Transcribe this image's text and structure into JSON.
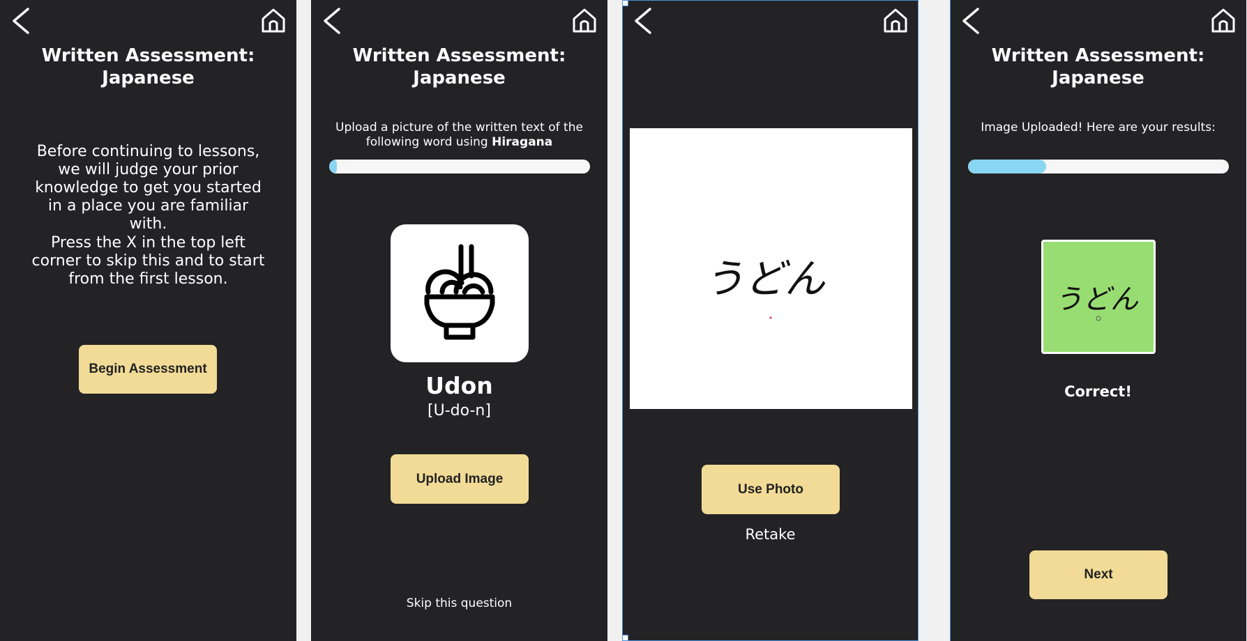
{
  "colors": {
    "background": "#232325",
    "button": "#f1db96",
    "button_text": "#222222",
    "progress_track": "#f6f6f6",
    "progress_fill": "#89d6f3",
    "result_correct": "#98dd72"
  },
  "icons": {
    "back": "chevron-left-icon",
    "home": "home-icon",
    "food": "noodle-bowl-icon"
  },
  "screen1": {
    "title": "Written Assessment: Japanese",
    "intro_p1": "Before continuing to lessons, we will judge your prior knowledge to get you started in a place you are familiar with.",
    "intro_p2": "Press the X in the top left corner to skip this and  to start from the first lesson.",
    "begin_button": "Begin Assessment"
  },
  "screen2": {
    "title": "Written Assessment: Japanese",
    "instruction_prefix": "Upload a picture of the written text of the following word using ",
    "instruction_script": "Hiragana",
    "progress": 0.03,
    "word": "Udon",
    "reading": "[U-do-n]",
    "upload_button": "Upload Image",
    "skip_link": "Skip this question"
  },
  "screen3": {
    "handwriting": "うどん",
    "use_photo_button": "Use Photo",
    "retake_link": "Retake"
  },
  "screen4": {
    "title": "Written Assessment: Japanese",
    "status": "Image Uploaded! Here are your results:",
    "progress": 0.3,
    "handwriting": "うどん",
    "verdict": "Correct!",
    "next_button": "Next"
  }
}
